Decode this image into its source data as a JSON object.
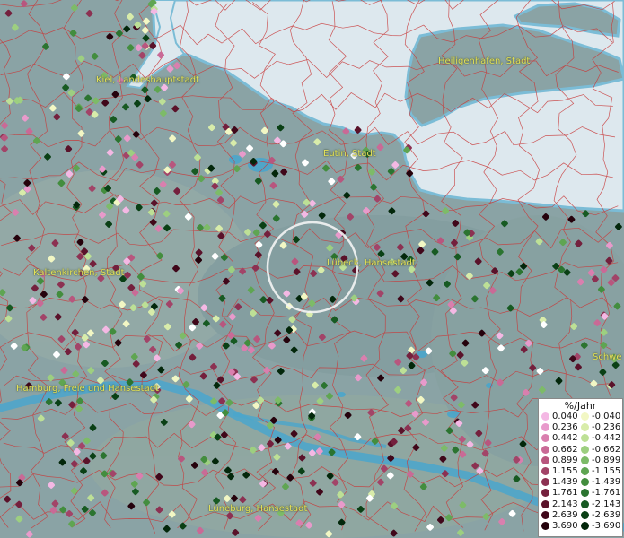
{
  "cities": [
    {
      "key": "kiel",
      "name": "Kiel, Landeshauptstadt"
    },
    {
      "key": "heiligenhafen",
      "name": "Heiligenhafen, Stadt"
    },
    {
      "key": "eutin",
      "name": "Eutin, Stadt"
    },
    {
      "key": "luebeck",
      "name": "Lübeck, Hansestadt"
    },
    {
      "key": "kaltenkirchen",
      "name": "Kaltenkirchen, Stadt"
    },
    {
      "key": "hamburg",
      "name": "Hamburg, Freie und Hansestadt"
    },
    {
      "key": "lueneburg",
      "name": "Lüneburg, Hansestadt"
    },
    {
      "key": "schwerin",
      "name": "Schwe"
    }
  ],
  "legend": {
    "title": "%/Jahr",
    "positive": [
      {
        "label": "0.040",
        "color": "#f4b8e4"
      },
      {
        "label": "0.236",
        "color": "#e89acb"
      },
      {
        "label": "0.442",
        "color": "#d97fae"
      },
      {
        "label": "0.662",
        "color": "#c96a96"
      },
      {
        "label": "0.899",
        "color": "#b8567e"
      },
      {
        "label": "1.155",
        "color": "#a24468"
      },
      {
        "label": "1.439",
        "color": "#8c3152"
      },
      {
        "label": "1.761",
        "color": "#74203d"
      },
      {
        "label": "2.143",
        "color": "#5a122a"
      },
      {
        "label": "2.639",
        "color": "#40071a"
      },
      {
        "label": "3.690",
        "color": "#25020c"
      }
    ],
    "negative": [
      {
        "label": "-0.040",
        "color": "#f2f7c4"
      },
      {
        "label": "-0.236",
        "color": "#d8ecaa"
      },
      {
        "label": "-0.442",
        "color": "#bde096"
      },
      {
        "label": "-0.662",
        "color": "#9dcf80"
      },
      {
        "label": "-0.899",
        "color": "#7dbb68"
      },
      {
        "label": "-1.155",
        "color": "#5fa552"
      },
      {
        "label": "-1.439",
        "color": "#438d3e"
      },
      {
        "label": "-1.761",
        "color": "#2b7430"
      },
      {
        "label": "-2.143",
        "color": "#175a22"
      },
      {
        "label": "-2.639",
        "color": "#0a4015"
      },
      {
        "label": "-3.690",
        "color": "#03270b"
      }
    ]
  }
}
